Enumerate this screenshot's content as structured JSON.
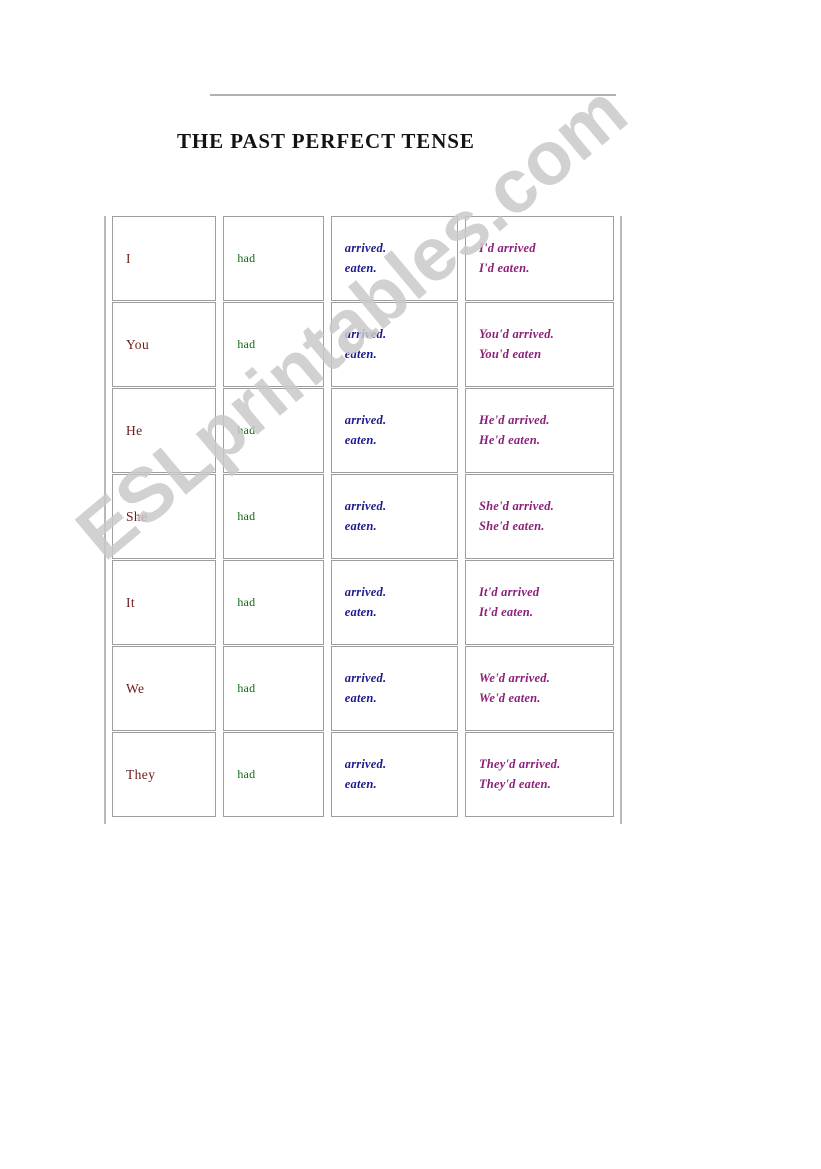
{
  "page": {
    "title": "THE PAST PERFECT TENSE",
    "watermark": "ESLprintables.com",
    "colors": {
      "subject": "#6d1a1a",
      "auxiliary": "#0d6b16",
      "verbs": "#1a1a8c",
      "short_forms": "#8b1f7a",
      "cell_border": "#9e9e9e",
      "frame_rule": "#b9b9b9",
      "title": "#131313",
      "watermark": "#c9c9c9"
    }
  },
  "table": {
    "columns": [
      "subject",
      "auxiliary",
      "verbs",
      "short_forms"
    ],
    "rows": [
      {
        "subject": "I",
        "auxiliary": "had",
        "verb1": "arrived.",
        "verb2": "eaten.",
        "short1": "I'd arrived",
        "short2": "I'd eaten."
      },
      {
        "subject": "You",
        "auxiliary": "had",
        "verb1": "arrived.",
        "verb2": "eaten.",
        "short1": "You'd arrived.",
        "short2": "You'd eaten"
      },
      {
        "subject": "He",
        "auxiliary": "had",
        "verb1": "arrived.",
        "verb2": "eaten.",
        "short1": "He'd arrived.",
        "short2": "He'd eaten."
      },
      {
        "subject": "She",
        "auxiliary": "had",
        "verb1": "arrived.",
        "verb2": "eaten.",
        "short1": "She'd arrived.",
        "short2": "She'd eaten."
      },
      {
        "subject": "It",
        "auxiliary": "had",
        "verb1": "arrived.",
        "verb2": "eaten.",
        "short1": "It'd arrived",
        "short2": "It'd eaten."
      },
      {
        "subject": "We",
        "auxiliary": "had",
        "verb1": "arrived.",
        "verb2": "eaten.",
        "short1": "We'd arrived.",
        "short2": "We'd eaten."
      },
      {
        "subject": "They",
        "auxiliary": "had",
        "verb1": "arrived.",
        "verb2": "eaten.",
        "short1": "They'd arrived.",
        "short2": "They'd eaten."
      }
    ]
  }
}
